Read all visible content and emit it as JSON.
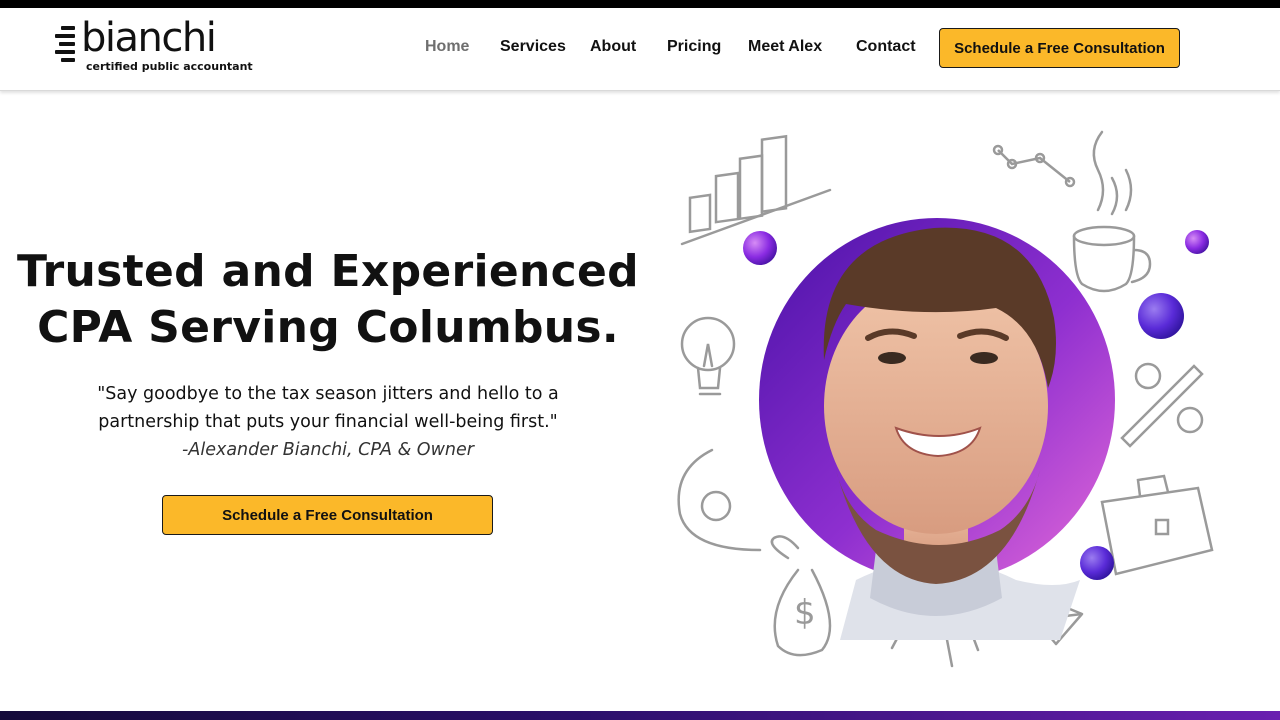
{
  "brand": {
    "name": "bianchi",
    "tagline": "certified public accountant"
  },
  "nav": {
    "items": [
      {
        "label": "Home",
        "active": true
      },
      {
        "label": "Services"
      },
      {
        "label": "About"
      },
      {
        "label": "Pricing"
      },
      {
        "label": "Meet Alex"
      },
      {
        "label": "Contact"
      }
    ],
    "cta_label": "Schedule a Free Consultation"
  },
  "hero": {
    "title_line1": "Trusted and Experienced",
    "title_line2": "CPA Serving Columbus.",
    "quote_line1": "\"Say goodbye to the tax season jitters and hello to a",
    "quote_line2": "partnership that puts your financial well-being first.\"",
    "attribution": "-Alexander Bianchi, CPA & Owner",
    "cta_label": "Schedule a Free Consultation"
  },
  "colors": {
    "accent_yellow": "#fbb829",
    "purple_dark": "#5a1fb0",
    "purple_light": "#d455d8",
    "nav_active": "#6f6f6f"
  },
  "icons": [
    "bar-chart-icon",
    "line-graph-icon",
    "coffee-mug-icon",
    "lightbulb-icon",
    "percent-icon",
    "briefcase-icon",
    "money-bag-icon",
    "paper-plane-icon"
  ]
}
